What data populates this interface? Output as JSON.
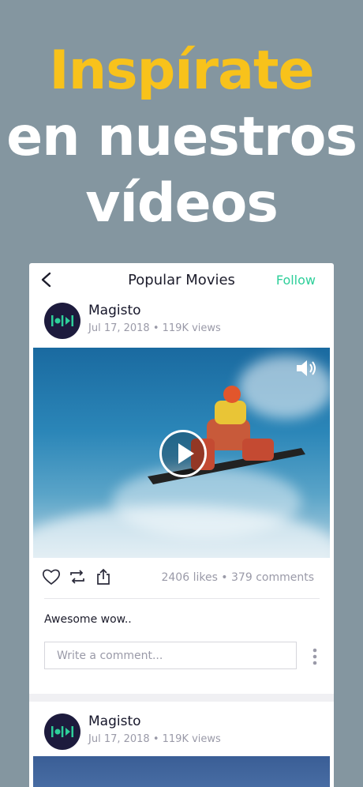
{
  "headline": {
    "line1": "Inspírate",
    "line2": "en nuestros",
    "line3": "vídeos"
  },
  "nav": {
    "title": "Popular Movies",
    "follow": "Follow"
  },
  "post1": {
    "user": "Magisto",
    "meta": "Jul 17, 2018 • 119K views",
    "stats": "2406 likes • 379 comments",
    "caption": "Awesome wow..",
    "comment_placeholder": "Write a comment..."
  },
  "post2": {
    "user": "Magisto",
    "meta": "Jul 17, 2018 • 119K views"
  },
  "colors": {
    "background": "#8496a0",
    "accent_yellow": "#f8c21b",
    "follow_green": "#2ecf9a",
    "avatar_bg": "#1d1b3d"
  },
  "icons": [
    "back-icon",
    "magisto-logo-icon",
    "speaker-icon",
    "play-icon",
    "heart-icon",
    "repost-icon",
    "share-icon",
    "more-vertical-icon"
  ]
}
